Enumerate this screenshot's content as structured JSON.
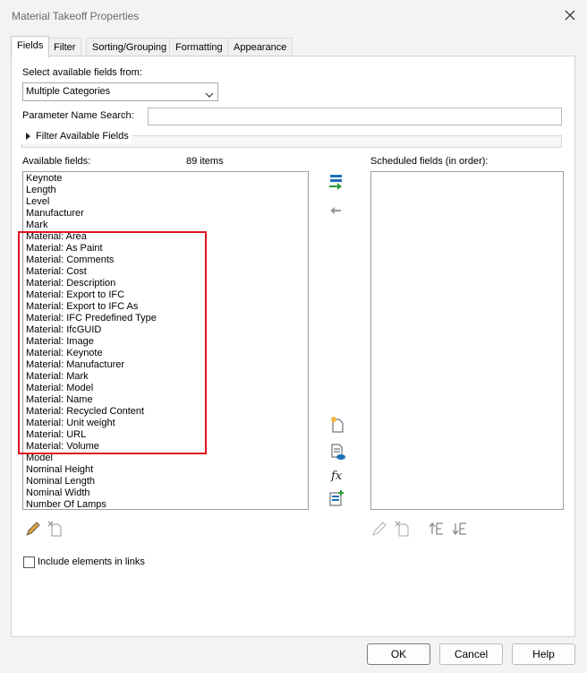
{
  "window": {
    "title": "Material Takeoff Properties"
  },
  "tabs": [
    {
      "label": "Fields",
      "active": true
    },
    {
      "label": "Filter"
    },
    {
      "label": "Sorting/Grouping"
    },
    {
      "label": "Formatting"
    },
    {
      "label": "Appearance"
    }
  ],
  "fields_tab": {
    "select_from_label": "Select available fields from:",
    "category_select_value": "Multiple Categories",
    "param_search_label": "Parameter Name Search:",
    "param_search_value": "",
    "filter_available_label": "Filter Available Fields",
    "available_label": "Available fields:",
    "item_count": "89 items",
    "scheduled_label": "Scheduled fields (in order):",
    "available_items": [
      "Keynote",
      "Length",
      "Level",
      "Manufacturer",
      "Mark",
      "Material: Area",
      "Material: As Paint",
      "Material: Comments",
      "Material: Cost",
      "Material: Description",
      "Material: Export to IFC",
      "Material: Export to IFC As",
      "Material: IFC Predefined Type",
      "Material: IfcGUID",
      "Material: Image",
      "Material: Keynote",
      "Material: Manufacturer",
      "Material: Mark",
      "Material: Model",
      "Material: Name",
      "Material: Recycled Content",
      "Material: Unit weight",
      "Material: URL",
      "Material: Volume",
      "Model",
      "Nominal Height",
      "Nominal Length",
      "Nominal Width",
      "Number Of Lamps"
    ],
    "scheduled_items": [],
    "include_links_label": "Include elements in links",
    "include_links_checked": false
  },
  "buttons": {
    "ok": "OK",
    "cancel": "Cancel",
    "help": "Help"
  },
  "colors": {
    "highlight": "#e0131f",
    "icon_blue": "#1f6fb5",
    "icon_green": "#2e9a3a"
  }
}
